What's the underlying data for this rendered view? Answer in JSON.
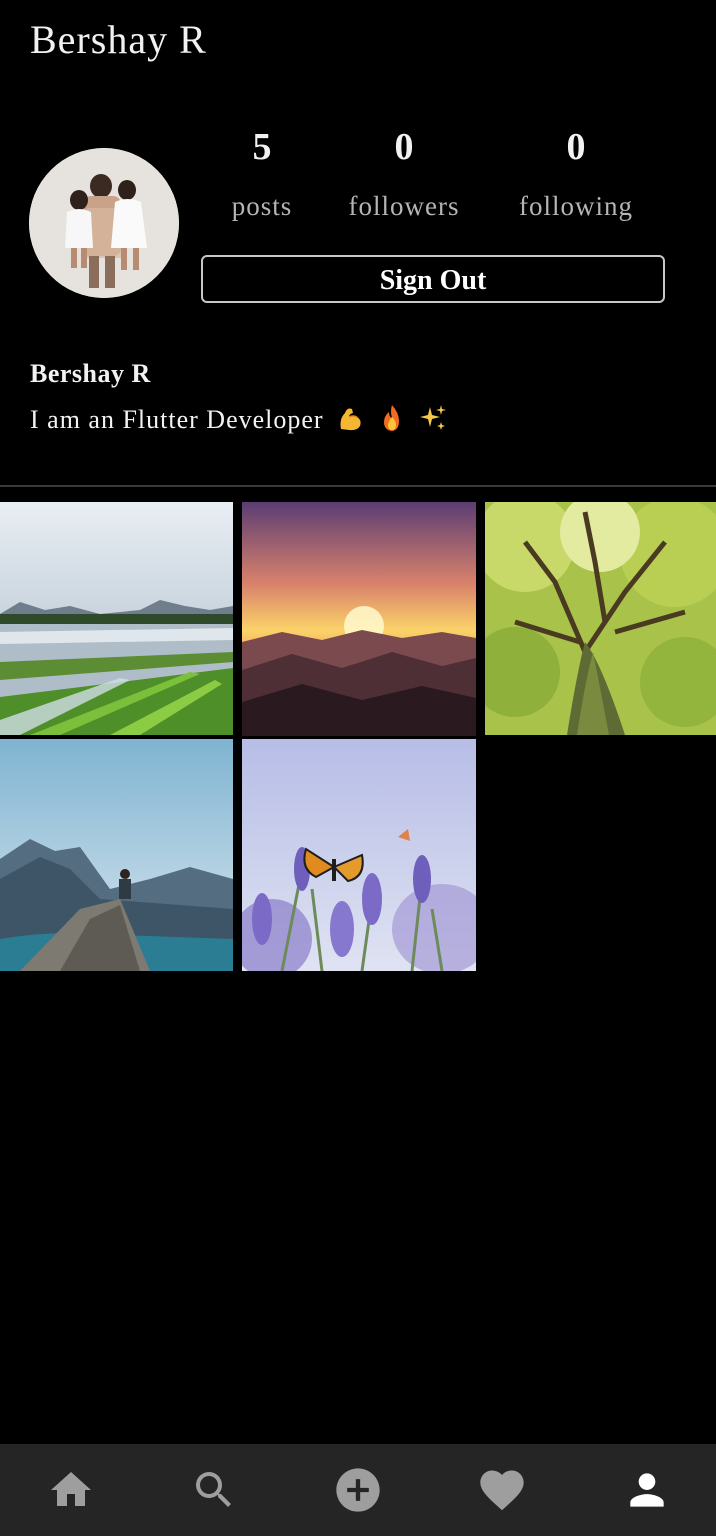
{
  "app_bar": {
    "title": "Bershay R"
  },
  "profile": {
    "stats": [
      {
        "value": "5",
        "label": "posts"
      },
      {
        "value": "0",
        "label": "followers"
      },
      {
        "value": "0",
        "label": "following"
      }
    ],
    "sign_out_label": "Sign Out",
    "name": "Bershay R",
    "bio": "I am an Flutter Developer",
    "bio_emojis": [
      "flexed-biceps",
      "fire",
      "sparkles"
    ]
  },
  "posts": [
    {
      "icon": "rice-field-photo"
    },
    {
      "icon": "mountain-sunset-photo"
    },
    {
      "icon": "tree-canopy-photo"
    },
    {
      "icon": "hiker-on-rock-photo"
    },
    {
      "icon": "butterfly-lavender-photo"
    }
  ],
  "bottom_nav": {
    "items": [
      {
        "icon": "home-icon",
        "active": false
      },
      {
        "icon": "search-icon",
        "active": false
      },
      {
        "icon": "add-circle-icon",
        "active": false
      },
      {
        "icon": "heart-icon",
        "active": false
      },
      {
        "icon": "person-icon",
        "active": true
      }
    ],
    "active_color": "#ffffff",
    "inactive_color": "#9e9e9e"
  }
}
